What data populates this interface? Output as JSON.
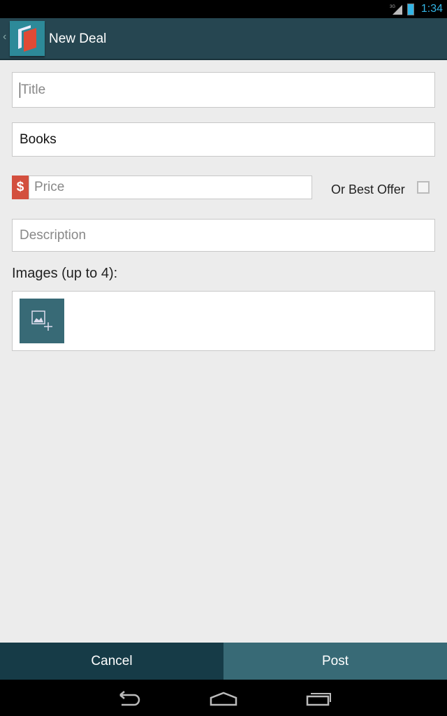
{
  "status_bar": {
    "network": "3G",
    "time": "1:34",
    "battery_color": "#33b5e5"
  },
  "action_bar": {
    "title": "New Deal",
    "background": "#264651"
  },
  "form": {
    "title": {
      "placeholder": "Title",
      "value": ""
    },
    "category": {
      "value": "Books"
    },
    "price": {
      "currency_symbol": "$",
      "placeholder": "Price",
      "value": ""
    },
    "or_best_offer": {
      "label": "Or Best Offer",
      "checked": false
    },
    "description": {
      "placeholder": "Description",
      "value": ""
    },
    "images_label": "Images (up to 4):"
  },
  "footer": {
    "cancel_label": "Cancel",
    "post_label": "Post",
    "cancel_color": "#163b47",
    "post_color": "#386a76"
  },
  "nav_bar": {
    "icons": [
      "back-icon",
      "home-icon",
      "recent-apps-icon"
    ]
  }
}
